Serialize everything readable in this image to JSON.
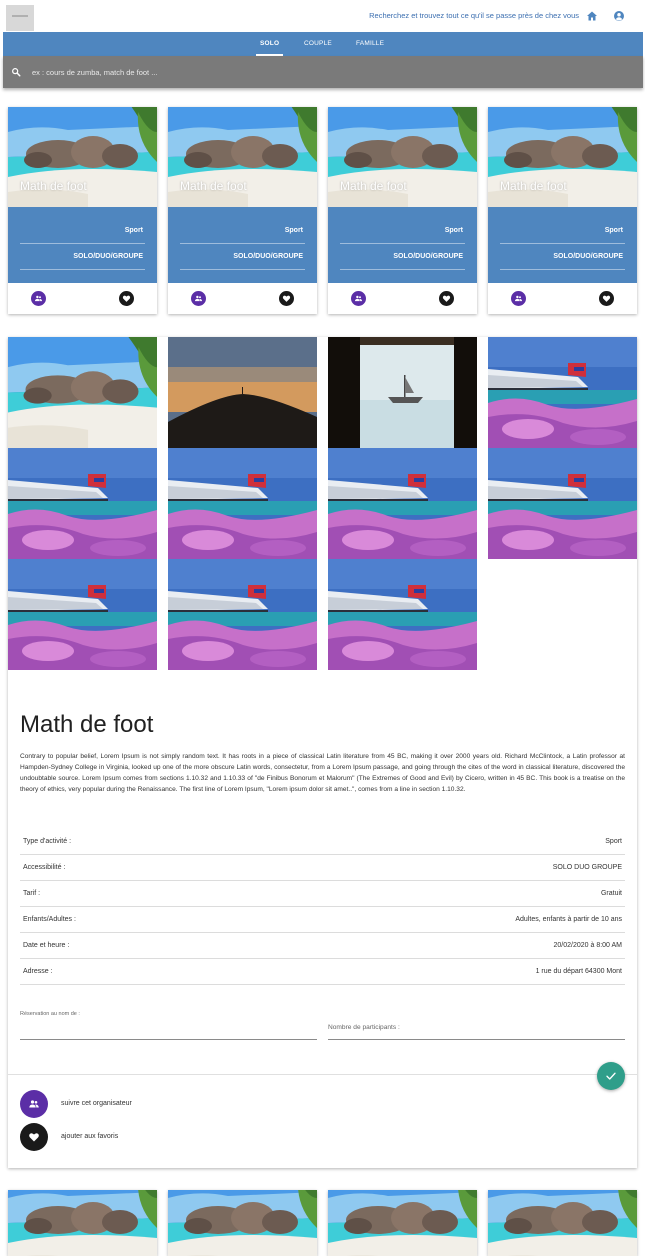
{
  "header": {
    "search_hint": "Recherchez et trouvez tout ce qu'il se passe près de chez vous",
    "home_icon": "home-icon",
    "account_icon": "account-circle-icon"
  },
  "tabs": [
    "SOLO",
    "COUPLE",
    "FAMILLE"
  ],
  "active_tab": "SOLO",
  "search": {
    "placeholder": "ex : cours de zumba, match de foot ..."
  },
  "cards": [
    {
      "title": "Math de foot",
      "category": "Sport",
      "accessibility": "SOLO/DUO/GROUPE"
    },
    {
      "title": "Math de foot",
      "category": "Sport",
      "accessibility": "SOLO/DUO/GROUPE"
    },
    {
      "title": "Math de foot",
      "category": "Sport",
      "accessibility": "SOLO/DUO/GROUPE"
    },
    {
      "title": "Math de foot",
      "category": "Sport",
      "accessibility": "SOLO/DUO/GROUPE"
    }
  ],
  "detail": {
    "title": "Math de foot",
    "description": "Contrary to popular belief, Lorem Ipsum is not simply random text. It has roots in a piece of classical Latin literature from 45 BC, making it over 2000 years old. Richard McClintock, a Latin professor at Hampden-Sydney College in Virginia, looked up one of the more obscure Latin words, consectetur, from a Lorem Ipsum passage, and going through the cites of the word in classical literature, discovered the undoubtable source. Lorem Ipsum comes from sections 1.10.32 and 1.10.33 of \"de Finibus Bonorum et Malorum\" (The Extremes of Good and Evil) by Cicero, written in 45 BC. This book is a treatise on the theory of ethics, very popular during the Renaissance. The first line of Lorem Ipsum, \"Lorem ipsum dolor sit amet..\", comes from a line in section 1.10.32.",
    "info": [
      {
        "label": "Type d'activité :",
        "value": "Sport"
      },
      {
        "label": "Accessibilité :",
        "value": "SOLO DUO GROUPE"
      },
      {
        "label": "Tarif :",
        "value": "Gratuit"
      },
      {
        "label": "Enfants/Adultes :",
        "value": "Adultes, enfants à partir de 10 ans"
      },
      {
        "label": "Date et heure :",
        "value": "20/02/2020 à 8:00 AM"
      },
      {
        "label": "Adresse :",
        "value": "1 rue du départ 64300 Mont"
      }
    ],
    "reservation_label": "Réservation au nom de :",
    "participants_label": "Nombre de participants :",
    "follow_label": "suivre cet organisateur",
    "favorite_label": "ajouter aux favoris"
  },
  "colors": {
    "primary": "#4f86bf",
    "search_bar": "#7a7a7a",
    "follow": "#5b2ea6",
    "favorite": "#1a1a1a",
    "confirm": "#2f9e8a"
  }
}
